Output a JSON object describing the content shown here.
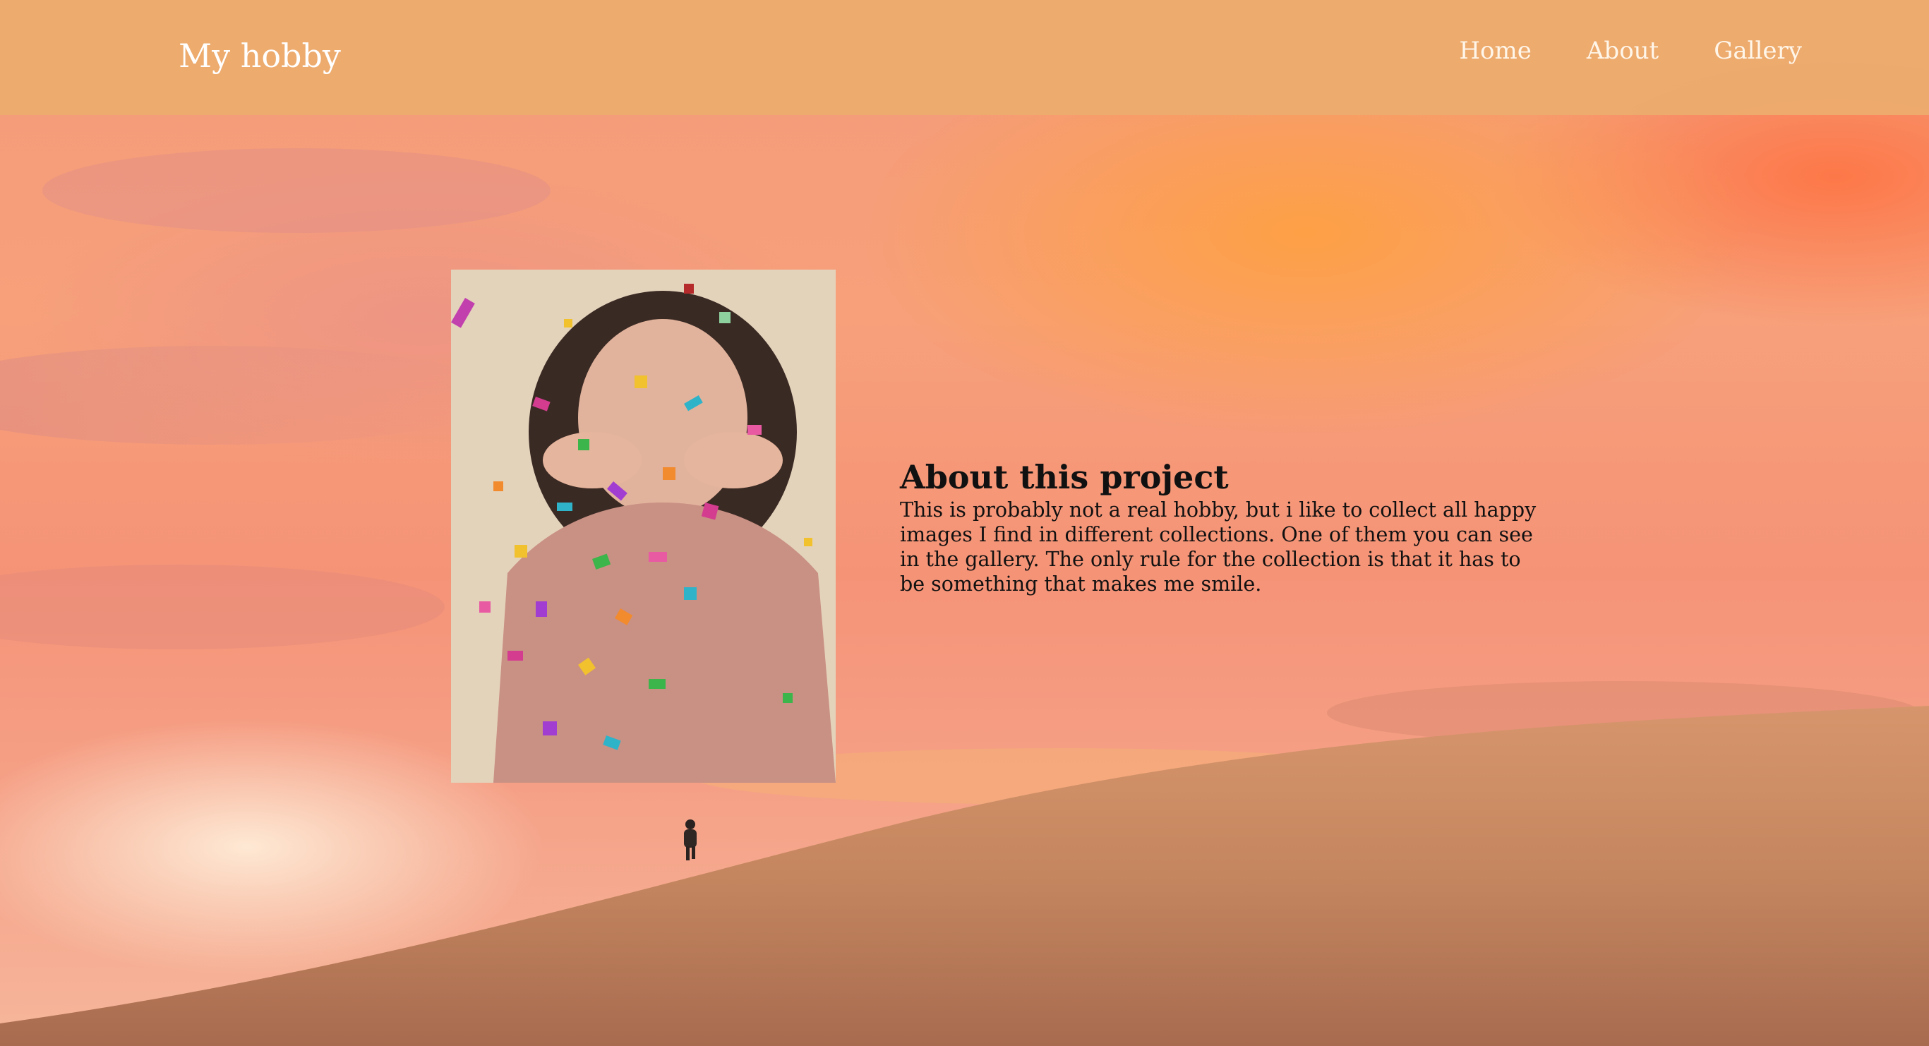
{
  "header": {
    "brand": "My hobby",
    "nav": [
      {
        "label": "Home"
      },
      {
        "label": "About"
      },
      {
        "label": "Gallery"
      }
    ]
  },
  "about": {
    "title": "About this project",
    "text": "This is probably not a real hobby, but i like to collect all happy images I find in different collections. One of them you can see in the gallery. The only rule for the collection is that it has to be something that makes me smile."
  },
  "colors": {
    "navbar": "#ecac6e",
    "sky": "#f59377",
    "dune": "#c98a64",
    "text": "#111111"
  }
}
